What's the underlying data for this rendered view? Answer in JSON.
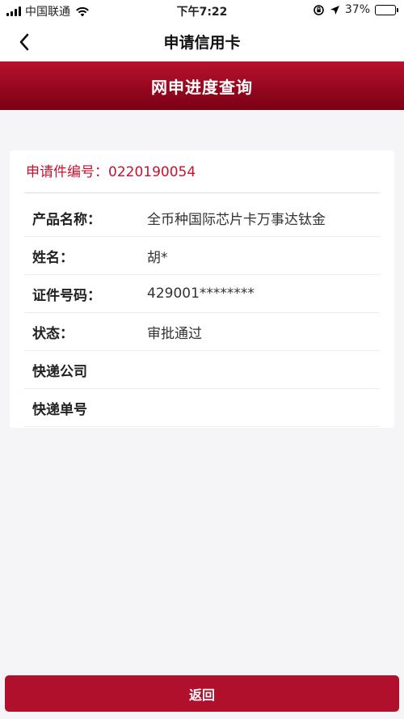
{
  "status_bar": {
    "carrier": "中国联通",
    "time": "下午7:22",
    "battery_percent": "37%",
    "battery_level": 0.37,
    "icons": [
      "signal-icon",
      "wifi-icon",
      "orientation-lock-icon",
      "location-icon",
      "battery-icon"
    ]
  },
  "nav": {
    "title": "申请信用卡",
    "back_icon": "chevron-left-icon"
  },
  "banner": {
    "title": "网申进度查询"
  },
  "card": {
    "application_number": "申请件编号：0220190054",
    "rows": [
      {
        "label": "产品名称：",
        "value": "全币种国际芯片卡万事达钛金"
      },
      {
        "label": "姓名：",
        "value": "胡*"
      },
      {
        "label": "证件号码：",
        "value": "429001********"
      },
      {
        "label": "状态：",
        "value": "审批通过"
      },
      {
        "label": "快递公司",
        "value": ""
      },
      {
        "label": "快递单号",
        "value": ""
      }
    ]
  },
  "footer": {
    "return_label": "返回"
  },
  "colors": {
    "brand_red": "#b0102c",
    "banner_dark": "#7a0014",
    "accent_text": "#c8102e",
    "background": "#f5f5f7"
  }
}
